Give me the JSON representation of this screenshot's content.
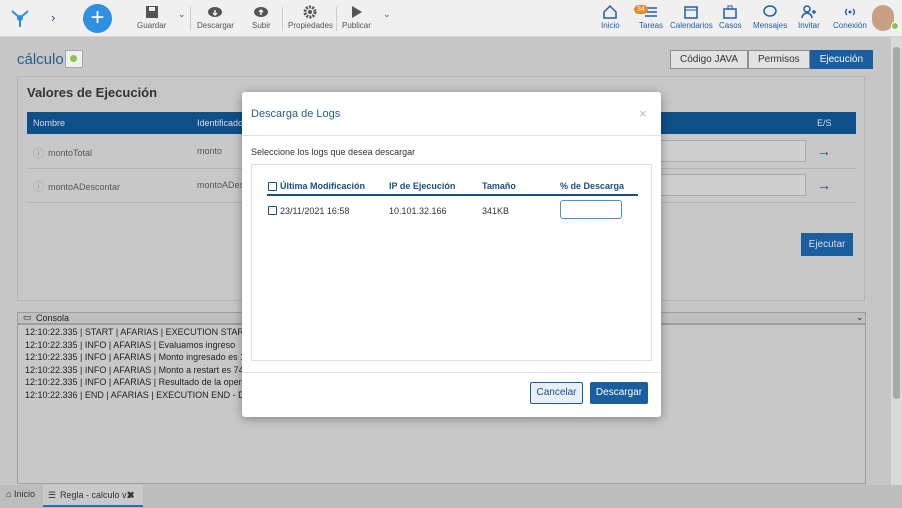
{
  "toolbar": {
    "save": "Guardar",
    "download": "Descargar",
    "upload": "Subir",
    "properties": "Propiedades",
    "publish": "Publicar"
  },
  "nav": {
    "home": "Inicio",
    "tasks": "Tareas",
    "tasks_badge": "34",
    "calendars": "Calendarios",
    "cases": "Casos",
    "messages": "Mensajes",
    "invite": "Invitar",
    "connection": "Conexión"
  },
  "page": {
    "title": "cálculo",
    "tabs": [
      "Código JAVA",
      "Permisos",
      "Ejecución"
    ],
    "panel_title": "Valores de Ejecución",
    "columns": {
      "name": "Nombre",
      "identifier": "Identificador",
      "io": "E/S"
    },
    "rows": [
      {
        "name": "montoTotal",
        "id": "monto"
      },
      {
        "name": "montoADescontar",
        "id": "montoADes"
      }
    ],
    "run_button": "Ejecutar"
  },
  "console": {
    "label": "Consola",
    "lines": [
      "12:10:22.335 | START | AFARIAS | EXECUTION START",
      "12:10:22.335 | INFO | AFARIAS | Evaluamos ingreso",
      "12:10:22.335 | INFO | AFARIAS | Monto ingresado es 145",
      "12:10:22.335 | INFO | AFARIAS | Monto a restart es 74",
      "12:10:22.335 | INFO | AFARIAS | Resultado de la operaci",
      "12:10:22.336 | END | AFARIAS | EXECUTION END - DU"
    ]
  },
  "footer": {
    "home": "Inicio",
    "tab": "Regla - calculo v1"
  },
  "modal": {
    "title": "Descarga de Logs",
    "subtitle": "Seleccione los logs que desea descargar",
    "headers": {
      "modified": "Última Modificación",
      "ip": "IP de Ejecución",
      "size": "Tamaño",
      "pct": "% de Descarga"
    },
    "row": {
      "modified": "23/11/2021 16:58",
      "ip": "10.101.32.166",
      "size": "341KB"
    },
    "cancel": "Cancelar",
    "download": "Descargar"
  },
  "colors": {
    "primary": "#1a5ea0",
    "accent": "#2f8fe0",
    "badge": "#e28b2b",
    "online": "#8bc34a"
  }
}
